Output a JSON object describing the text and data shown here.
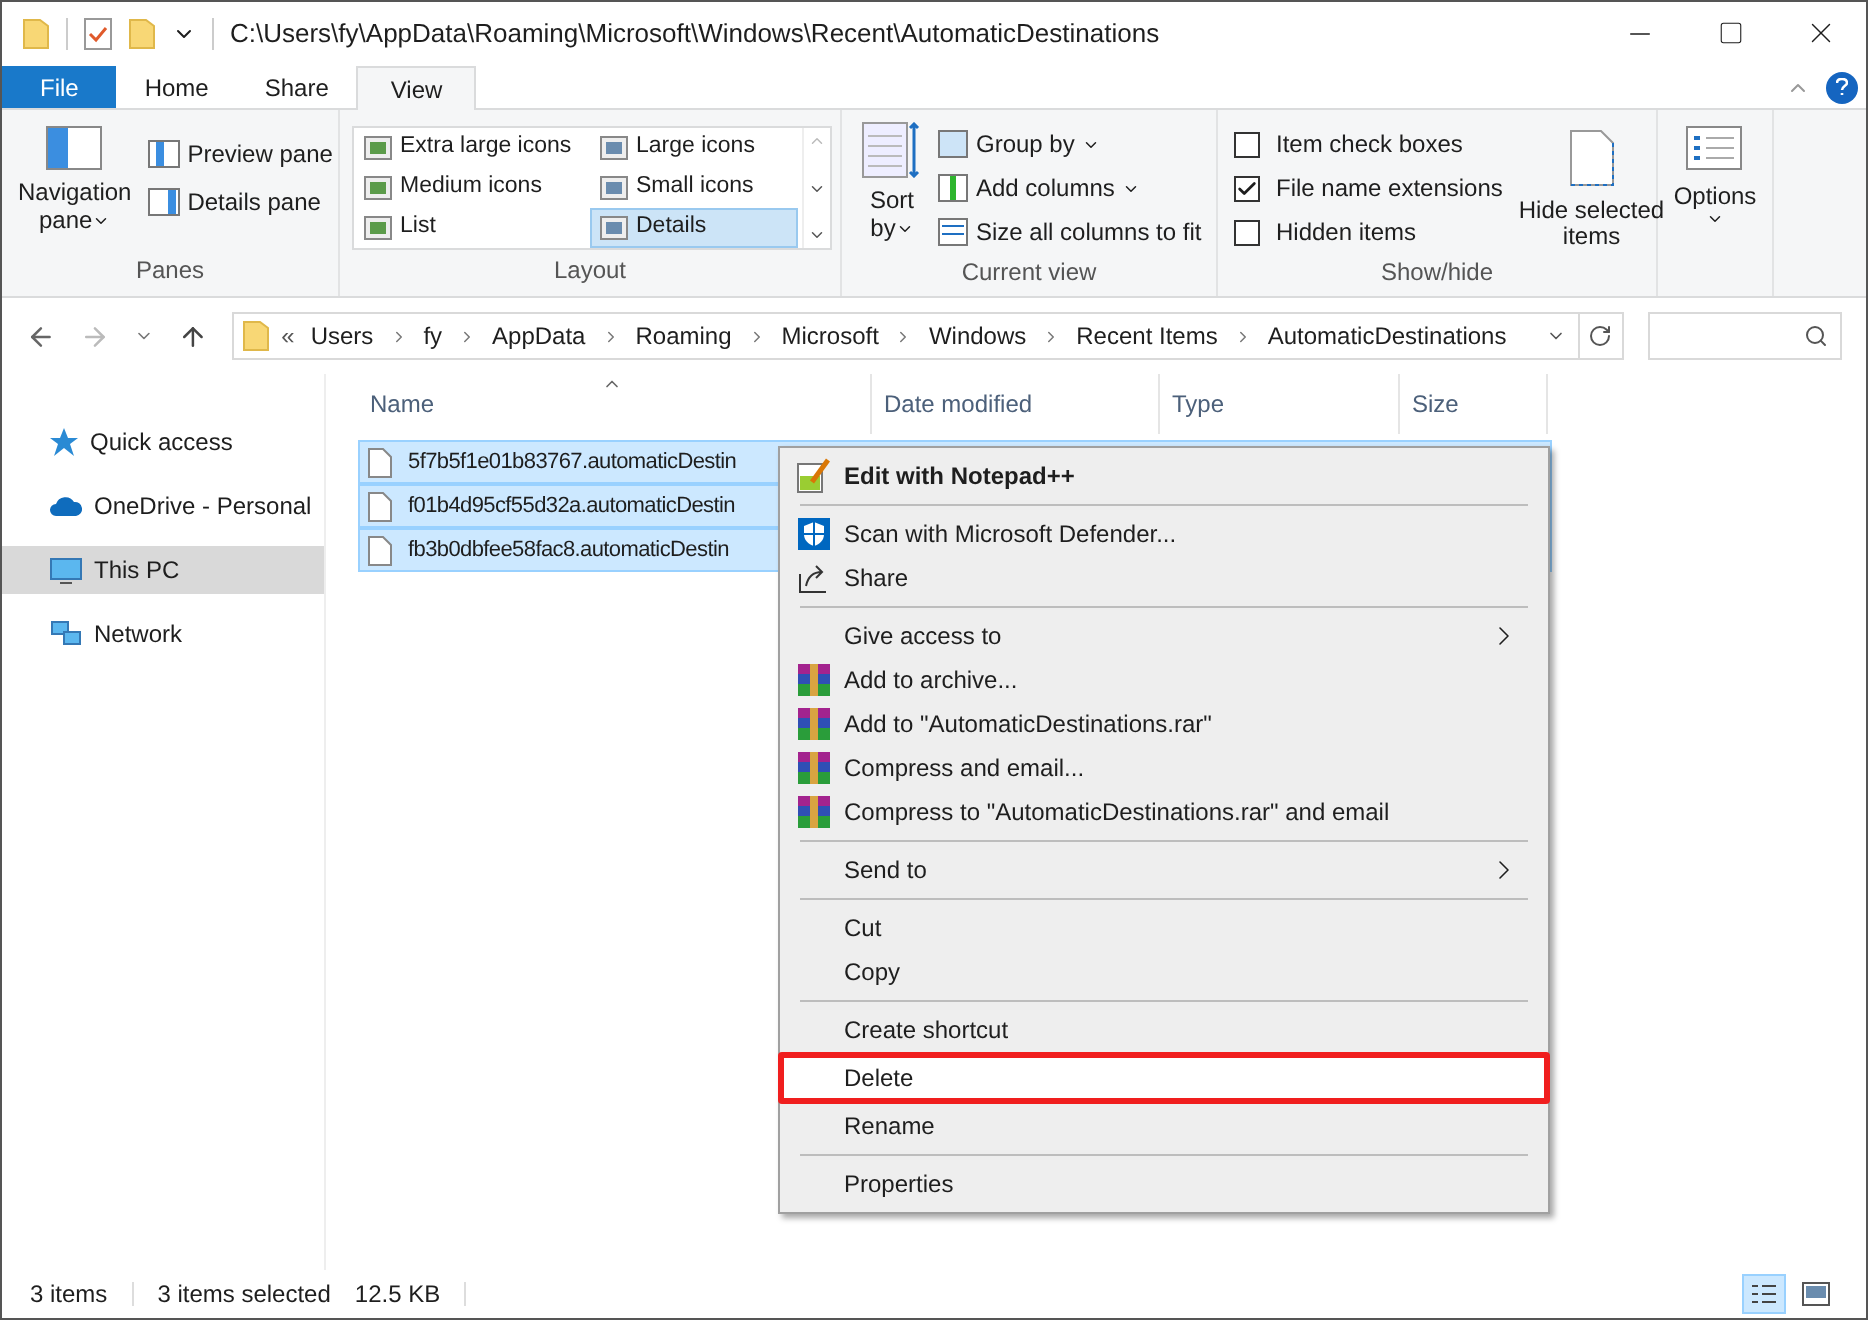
{
  "window": {
    "title": "C:\\Users\\fy\\AppData\\Roaming\\Microsoft\\Windows\\Recent\\AutomaticDestinations"
  },
  "ribbon_tabs": [
    {
      "label": "File",
      "selected": false,
      "kind": "file"
    },
    {
      "label": "Home",
      "selected": false,
      "kind": "tab"
    },
    {
      "label": "Share",
      "selected": false,
      "kind": "tab"
    },
    {
      "label": "View",
      "selected": true,
      "kind": "tab"
    }
  ],
  "panes": {
    "label": "Panes",
    "navigation": [
      "Navigation",
      "pane"
    ],
    "items": [
      "Preview pane",
      "Details pane"
    ]
  },
  "layout": {
    "label": "Layout",
    "items": [
      {
        "label": "Extra large icons",
        "selected": false
      },
      {
        "label": "Large icons",
        "selected": false
      },
      {
        "label": "Medium icons",
        "selected": false
      },
      {
        "label": "Small icons",
        "selected": false
      },
      {
        "label": "List",
        "selected": false
      },
      {
        "label": "Details",
        "selected": true
      }
    ]
  },
  "current_view": {
    "label": "Current view",
    "sort": [
      "Sort",
      "by"
    ],
    "items": [
      "Group by",
      "Add columns",
      "Size all columns to fit"
    ]
  },
  "show_hide": {
    "label": "Show/hide",
    "checkboxes": [
      {
        "label": "Item check boxes",
        "checked": false
      },
      {
        "label": "File name extensions",
        "checked": true
      },
      {
        "label": "Hidden items",
        "checked": false
      }
    ],
    "hide_selected": [
      "Hide selected",
      "items"
    ]
  },
  "options": {
    "label": "Options"
  },
  "address": {
    "overflow": "«",
    "crumbs": [
      "Users",
      "fy",
      "AppData",
      "Roaming",
      "Microsoft",
      "Windows",
      "Recent Items",
      "AutomaticDestinations"
    ]
  },
  "sidebar": {
    "items": [
      {
        "label": "Quick access",
        "selected": false
      },
      {
        "label": "OneDrive - Personal",
        "selected": false
      },
      {
        "label": "This PC",
        "selected": true
      },
      {
        "label": "Network",
        "selected": false
      }
    ]
  },
  "table": {
    "columns": [
      "Name",
      "Date modified",
      "Type",
      "Size"
    ],
    "rows": [
      {
        "name": "5f7b5f1e01b83767.automaticDestin",
        "selected": true
      },
      {
        "name": "f01b4d95cf55d32a.automaticDestin",
        "selected": true
      },
      {
        "name": "fb3b0dbfee58fac8.automaticDestin",
        "selected": true
      }
    ]
  },
  "context_menu": {
    "items": [
      {
        "kind": "item",
        "label": "Edit with Notepad++",
        "bold": true
      },
      {
        "kind": "separator"
      },
      {
        "kind": "item",
        "label": "Scan with Microsoft Defender..."
      },
      {
        "kind": "item",
        "label": "Share"
      },
      {
        "kind": "separator"
      },
      {
        "kind": "submenu",
        "label": "Give access to"
      },
      {
        "kind": "item",
        "label": "Add to archive..."
      },
      {
        "kind": "item",
        "label": "Add to \"AutomaticDestinations.rar\""
      },
      {
        "kind": "item",
        "label": "Compress and email..."
      },
      {
        "kind": "item",
        "label": "Compress to \"AutomaticDestinations.rar\" and email"
      },
      {
        "kind": "separator"
      },
      {
        "kind": "submenu",
        "label": "Send to"
      },
      {
        "kind": "separator"
      },
      {
        "kind": "item",
        "label": "Cut"
      },
      {
        "kind": "item",
        "label": "Copy"
      },
      {
        "kind": "separator"
      },
      {
        "kind": "item",
        "label": "Create shortcut"
      },
      {
        "kind": "item",
        "label": "Delete",
        "highlighted": true
      },
      {
        "kind": "item",
        "label": "Rename"
      },
      {
        "kind": "separator"
      },
      {
        "kind": "item",
        "label": "Properties"
      }
    ]
  },
  "status_bar": {
    "count": "3 items",
    "selected": "3 items selected",
    "size": "12.5 KB"
  }
}
